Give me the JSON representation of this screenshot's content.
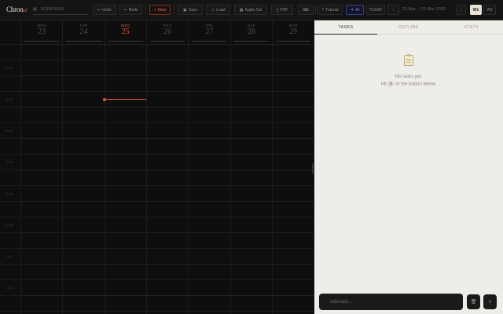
{
  "app": {
    "brand": "Chron",
    "brand_accent": "ai"
  },
  "doc_title": {
    "text": "SCHEDULE"
  },
  "toolbar": {
    "undo": "Undo",
    "redo": "Redo",
    "new": "New",
    "save": "Save",
    "load": "Load",
    "apple_cal": "Apple Cal",
    "pdf": "PDF",
    "tutorial": "Tutorial",
    "ai": "AI",
    "today": "TODAY",
    "prev": "‹",
    "next": "›",
    "range": "23 Mar – 29 Mar 2026",
    "view_w1": "W1",
    "view_w2": "W2"
  },
  "days": [
    {
      "name": "MON",
      "date": "23"
    },
    {
      "name": "TUE",
      "date": "24"
    },
    {
      "name": "WED",
      "date": "25"
    },
    {
      "name": "THU",
      "date": "26"
    },
    {
      "name": "FRI",
      "date": "27"
    },
    {
      "name": "SAT",
      "date": "28"
    },
    {
      "name": "SUN",
      "date": "29"
    }
  ],
  "time_labels": [
    "07:00",
    "08:00",
    "09:00",
    "10:00",
    "11:00",
    "12:00",
    "13:00",
    "14:00"
  ],
  "panel": {
    "tabs": [
      "TASKS",
      "OUTLINE",
      "STATS"
    ],
    "empty_title": "No tasks yet.",
    "empty_hint_prefix": "Hit",
    "empty_hint_key": "N",
    "empty_hint_suffix": "or the button below.",
    "add_placeholder": "Add task..."
  },
  "colors": {
    "accent": "#e0553b",
    "panel_bg": "#efede8",
    "calendar_bg": "#0e0e0e"
  },
  "icons": [
    "doc-icon",
    "undo-icon",
    "redo-icon",
    "plus-icon",
    "save-icon",
    "folder-icon",
    "calendar-icon",
    "pdf-icon",
    "keyboard-icon",
    "help-icon",
    "sparkle-icon",
    "clipboard-icon",
    "trash-icon",
    "menu-icon"
  ]
}
